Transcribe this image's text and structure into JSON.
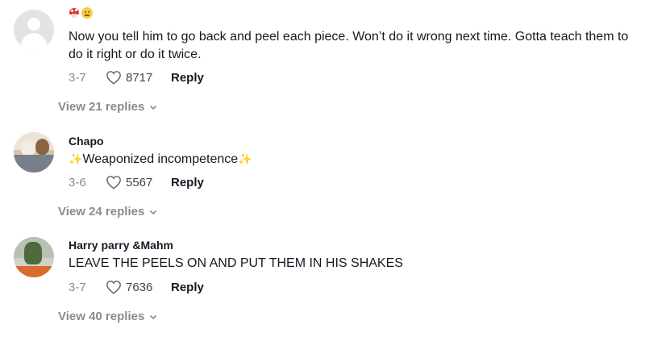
{
  "comments": [
    {
      "username": "",
      "text": "Now you tell him to go back and peel each piece. Won’t do it wrong next time. Gotta teach them to do it right or do it twice.",
      "date": "3-7",
      "likes": "8717",
      "reply_label": "Reply",
      "view_replies_label": "View 21 replies",
      "emojis": [
        "mushroom-emoji",
        "smiley-emoji"
      ]
    },
    {
      "username": "Chapo",
      "text": "Weaponized incompetence",
      "text_prefix": "✨",
      "text_suffix": "✨",
      "date": "3-6",
      "likes": "5567",
      "reply_label": "Reply",
      "view_replies_label": "View 24 replies"
    },
    {
      "username": "Harry parry &Mahm",
      "text": "LEAVE THE PEELS ON AND PUT THEM IN HIS SHAKES",
      "date": "3-7",
      "likes": "7636",
      "reply_label": "Reply",
      "view_replies_label": "View 40 replies"
    }
  ],
  "colors": {
    "text_primary": "#161823",
    "text_secondary": "#8a8b91",
    "background": "#ffffff"
  },
  "icons": [
    "heart-icon",
    "chevron-down-icon",
    "avatar"
  ]
}
